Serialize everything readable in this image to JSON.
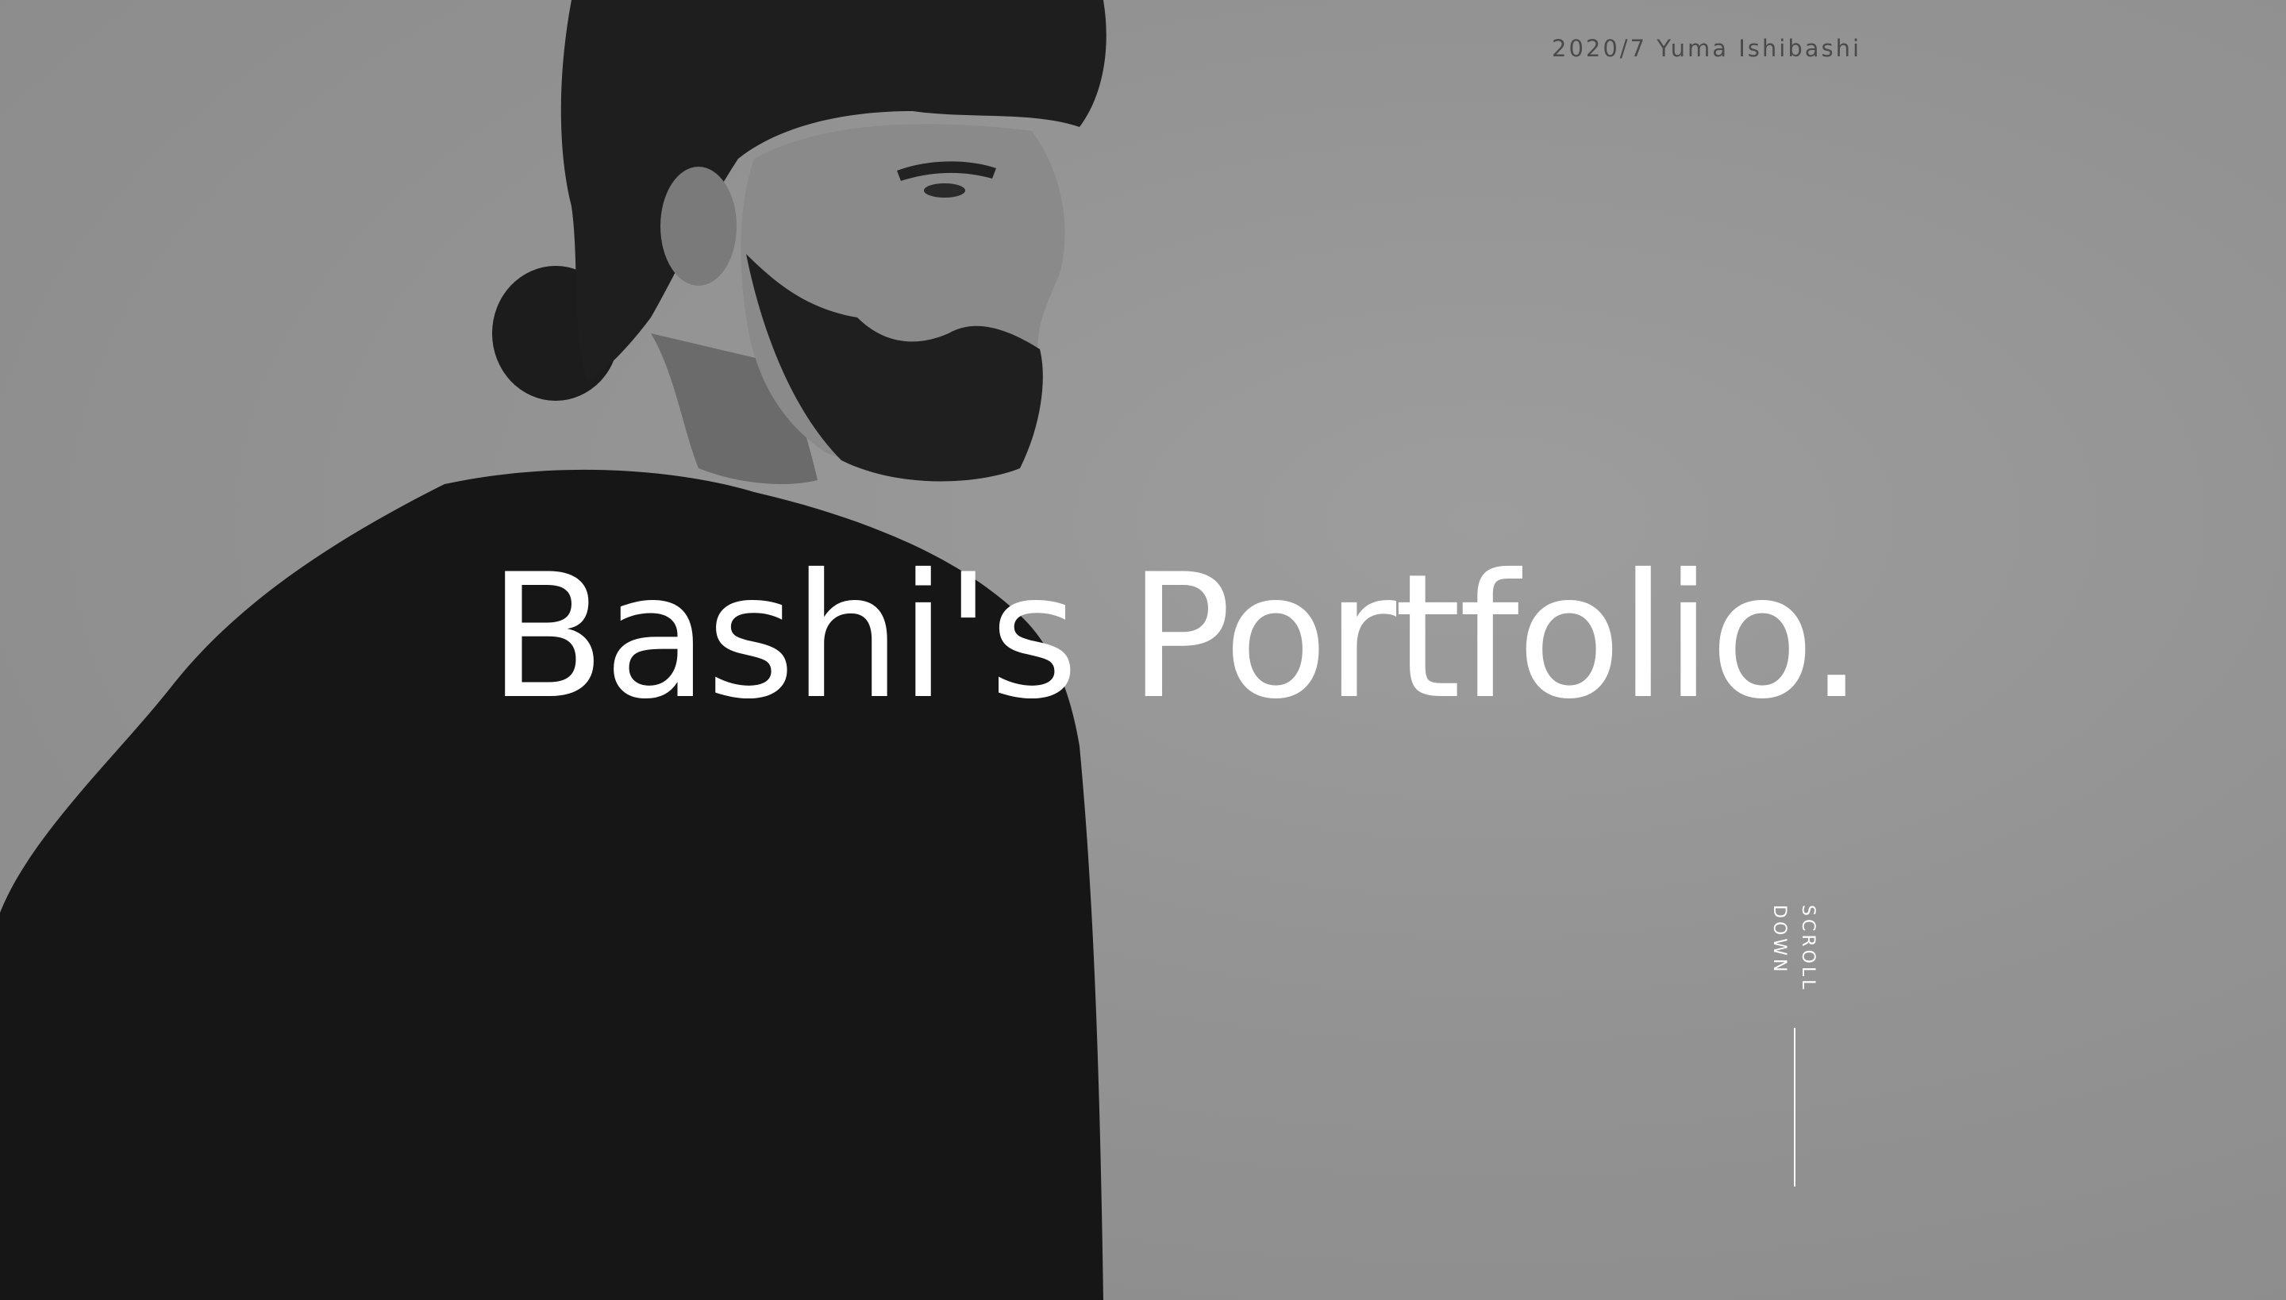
{
  "header": {
    "date_author": "2020/7 Yuma Ishibashi"
  },
  "hero": {
    "title": "Bashi's Portfolio.",
    "scroll_label": "SCROLL DOWN",
    "image_description": "black and white portrait photo",
    "colors": {
      "background": "#939393",
      "title": "#ffffff",
      "meta_text": "#4a4a4a",
      "figure": "#141414"
    }
  }
}
